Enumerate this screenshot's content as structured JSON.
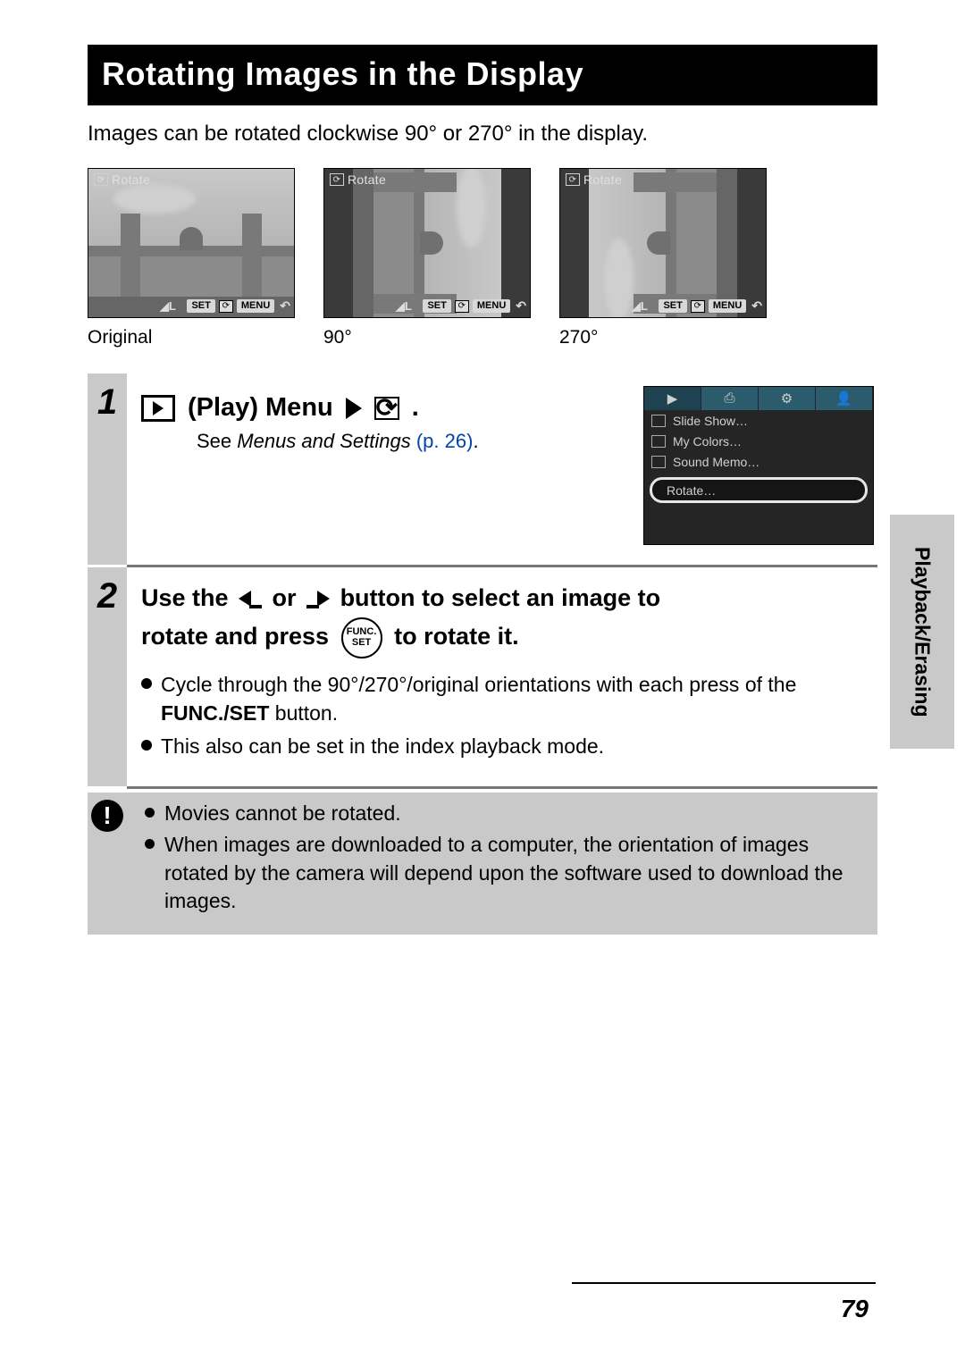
{
  "title": "Rotating Images in the Display",
  "intro": "Images can be rotated clockwise 90° or 270° in the display.",
  "examples": {
    "rotate_label": "Rotate",
    "set_badge": "SET",
    "menu_badge": "MENU",
    "caps": {
      "original": "Original",
      "deg90": "90°",
      "deg270": "270°"
    }
  },
  "step1": {
    "num": "1",
    "play_menu": "(Play) Menu",
    "dot": ".",
    "sub_prefix": "See ",
    "sub_italic": "Menus and Settings",
    "sub_link": " (p. 26)",
    "sub_dot": ".",
    "menu": {
      "tabs": [
        "▶",
        "⎙",
        "⚙",
        "👤"
      ],
      "items": [
        "Slide Show…",
        "My Colors…",
        "Sound Memo…"
      ],
      "rotate": "Rotate…"
    }
  },
  "step2": {
    "num": "2",
    "line1a": "Use the ",
    "line1b": " or ",
    "line1c": " button to select an image to",
    "line2a": "rotate and press ",
    "func_top": "FUNC.",
    "func_bot": "SET",
    "line2b": " to rotate it.",
    "bullets": [
      {
        "pre": "Cycle through the 90°/270°/original orientations with each press of the ",
        "bold": "FUNC./SET",
        "post": " button."
      },
      {
        "text": "This also can be set in the index playback mode."
      }
    ]
  },
  "note": {
    "icon": "!",
    "items": [
      "Movies cannot be rotated.",
      "When images are downloaded to a computer, the orientation of images rotated by the camera will depend upon the software used to download the images."
    ]
  },
  "side_tab": "Playback/Erasing",
  "page_number": "79"
}
